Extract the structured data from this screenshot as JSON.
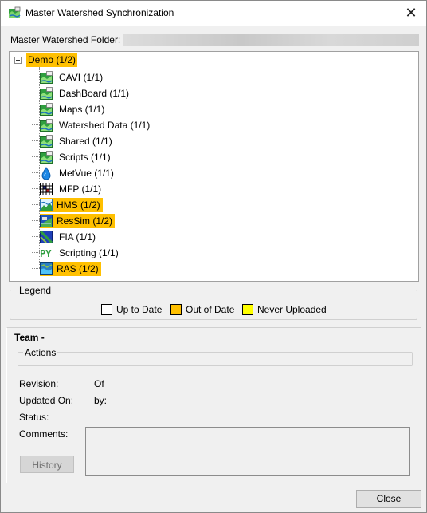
{
  "window": {
    "title": "Master Watershed Synchronization",
    "close_glyph": "✕"
  },
  "folder": {
    "label": "Master Watershed Folder:",
    "value": ""
  },
  "tree": {
    "root": {
      "label": "Demo (1/2)",
      "status": "out-of-date",
      "expander": "⊟"
    },
    "items": [
      {
        "label": "CAVI (1/1)",
        "icon": "watershed-icon",
        "status": "up-to-date"
      },
      {
        "label": "DashBoard (1/1)",
        "icon": "watershed-icon",
        "status": "up-to-date"
      },
      {
        "label": "Maps (1/1)",
        "icon": "watershed-icon",
        "status": "up-to-date"
      },
      {
        "label": "Watershed Data (1/1)",
        "icon": "watershed-icon",
        "status": "up-to-date"
      },
      {
        "label": "Shared (1/1)",
        "icon": "watershed-icon",
        "status": "up-to-date"
      },
      {
        "label": "Scripts (1/1)",
        "icon": "watershed-icon",
        "status": "up-to-date"
      },
      {
        "label": "MetVue (1/1)",
        "icon": "water-drop-icon",
        "status": "up-to-date"
      },
      {
        "label": "MFP (1/1)",
        "icon": "grid-icon",
        "status": "up-to-date"
      },
      {
        "label": "HMS (1/2)",
        "icon": "hms-icon",
        "status": "out-of-date"
      },
      {
        "label": "ResSim (1/2)",
        "icon": "ressim-icon",
        "status": "out-of-date"
      },
      {
        "label": "FIA (1/1)",
        "icon": "fia-icon",
        "status": "up-to-date"
      },
      {
        "label": "Scripting (1/1)",
        "icon": "python-icon",
        "status": "up-to-date"
      },
      {
        "label": "RAS (1/2)",
        "icon": "ras-icon",
        "status": "out-of-date"
      }
    ]
  },
  "legend": {
    "title": "Legend",
    "items": [
      {
        "label": "Up to Date",
        "color": "#ffffff"
      },
      {
        "label": "Out of Date",
        "color": "#ffc000"
      },
      {
        "label": "Never Uploaded",
        "color": "#ffff00"
      }
    ]
  },
  "team": {
    "title": "Team -",
    "actions_title": "Actions",
    "revision_label": "Revision:",
    "revision_value": "Of",
    "updated_label": "Updated On:",
    "updated_by": "by:",
    "status_label": "Status:",
    "comments_label": "Comments:",
    "history_label": "History"
  },
  "footer": {
    "close_label": "Close"
  },
  "colors": {
    "out_of_date": "#ffc000",
    "never_uploaded": "#ffff00",
    "up_to_date": "#ffffff"
  }
}
